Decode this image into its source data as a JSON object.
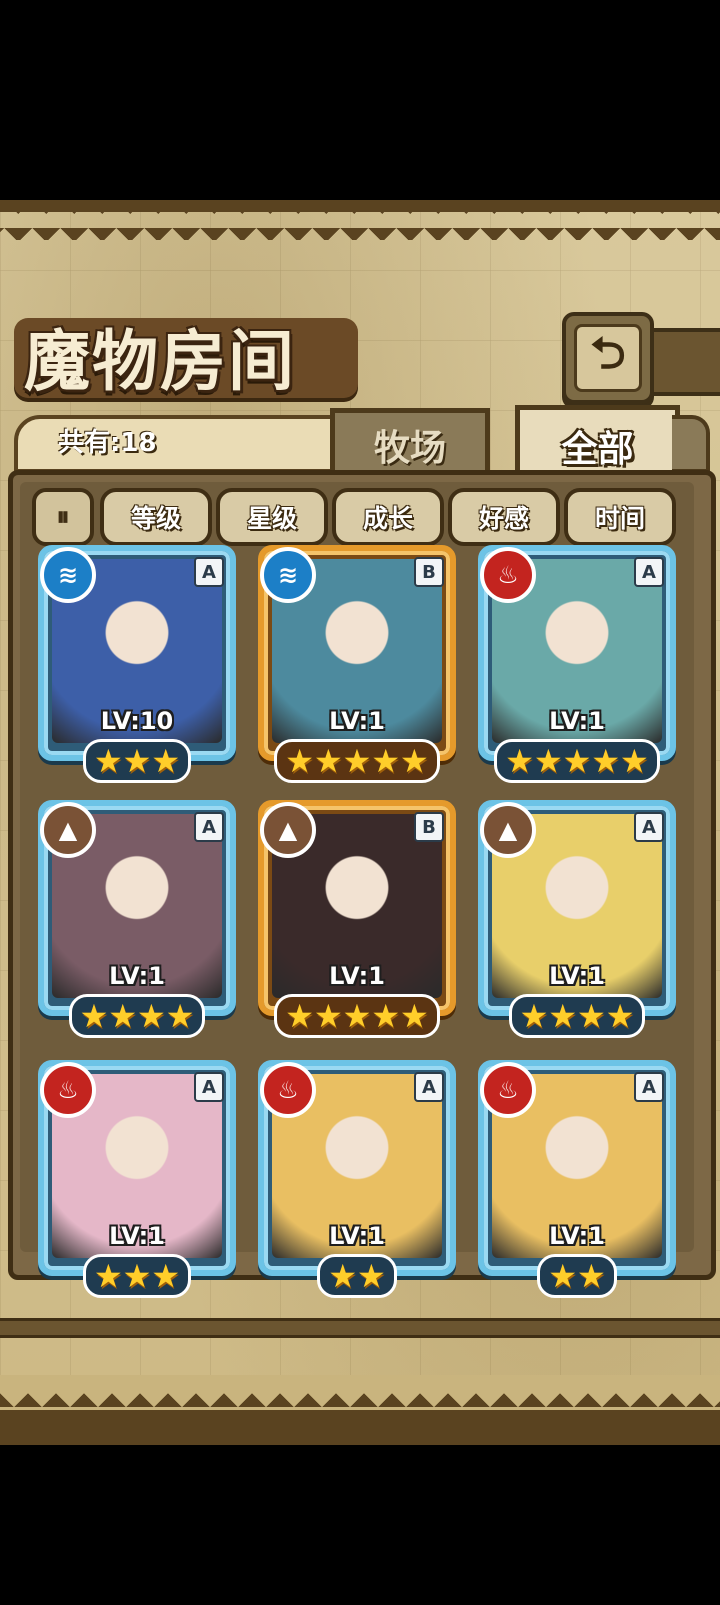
{
  "header": {
    "title": "魔物房间",
    "back_icon": "⮌"
  },
  "counter": {
    "label": "共有:18"
  },
  "tabs": [
    {
      "label": "牧场",
      "active": false
    },
    {
      "label": "全部",
      "active": true
    }
  ],
  "sort": {
    "toggle_label": "⏸",
    "buttons": [
      "等级",
      "星级",
      "成长",
      "好感",
      "时间"
    ]
  },
  "colors": {
    "panel": "#6f5c3c",
    "frame_blue": "#6cc3e6",
    "frame_gold": "#e59a2b",
    "water": "#1c7fc7",
    "fire": "#c3241f",
    "earth": "#7a5236"
  },
  "cards": [
    {
      "element": "water",
      "element_icon": "≋",
      "rank": "A",
      "frame": "blue",
      "level": "LV:10",
      "stars": 3,
      "stars_text": "★★★",
      "portrait": "#3d5fa8"
    },
    {
      "element": "water",
      "element_icon": "≋",
      "rank": "B",
      "frame": "gold",
      "level": "LV:1",
      "stars": 5,
      "stars_text": "★★★★★",
      "portrait": "#4d8a9e"
    },
    {
      "element": "fire",
      "element_icon": "♨",
      "rank": "A",
      "frame": "blue",
      "level": "LV:1",
      "stars": 5,
      "stars_text": "★★★★★",
      "portrait": "#6aa9a8"
    },
    {
      "element": "earth",
      "element_icon": "▲",
      "rank": "A",
      "frame": "blue",
      "level": "LV:1",
      "stars": 4,
      "stars_text": "★★★★",
      "portrait": "#7a5c66"
    },
    {
      "element": "earth",
      "element_icon": "▲",
      "rank": "B",
      "frame": "gold",
      "level": "LV:1",
      "stars": 5,
      "stars_text": "★★★★★",
      "portrait": "#3a2a2a"
    },
    {
      "element": "earth",
      "element_icon": "▲",
      "rank": "A",
      "frame": "blue",
      "level": "LV:1",
      "stars": 4,
      "stars_text": "★★★★",
      "portrait": "#e8cf6a"
    },
    {
      "element": "fire",
      "element_icon": "♨",
      "rank": "A",
      "frame": "blue",
      "level": "LV:1",
      "stars": 3,
      "stars_text": "★★★",
      "portrait": "#e5b7c8"
    },
    {
      "element": "fire",
      "element_icon": "♨",
      "rank": "A",
      "frame": "blue",
      "level": "LV:1",
      "stars": 2,
      "stars_text": "★★",
      "portrait": "#e9bf62"
    },
    {
      "element": "fire",
      "element_icon": "♨",
      "rank": "A",
      "frame": "blue",
      "level": "LV:1",
      "stars": 2,
      "stars_text": "★★",
      "portrait": "#e9bf62"
    }
  ]
}
